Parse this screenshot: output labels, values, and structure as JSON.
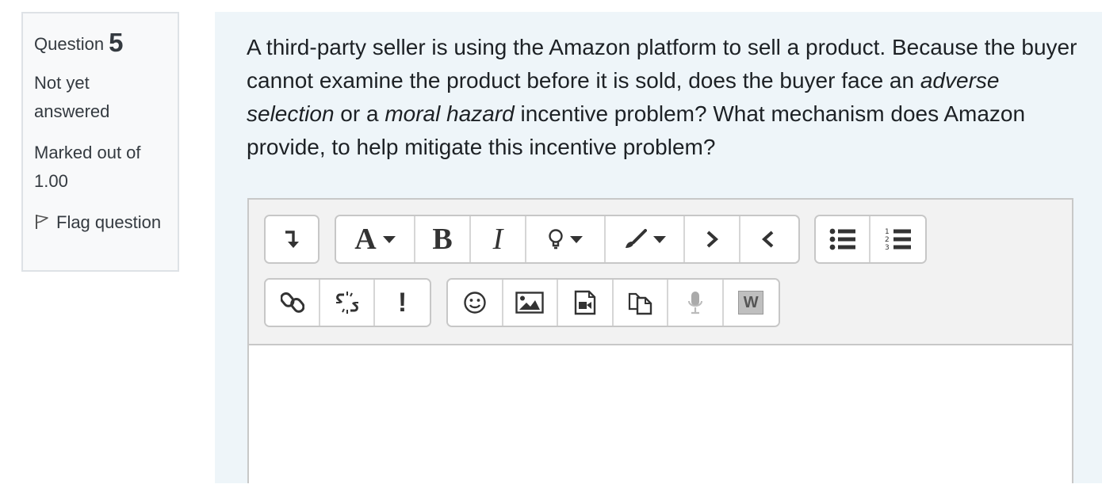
{
  "info": {
    "question_label": "Question",
    "question_number": "5",
    "state": "Not yet answered",
    "grade": "Marked out of 1.00",
    "flag_label": "Flag question"
  },
  "question": {
    "part1": "A third-party seller is using the Amazon platform to sell a product. Because the buyer cannot examine the product before it is sold, does the buyer face an ",
    "term1": "adverse selection",
    "part2": " or a ",
    "term2": "moral hazard",
    "part3": " incentive problem? What mechanism does Amazon provide, to help mitigate this incentive problem?"
  },
  "editor": {
    "toolbar_row1": [
      "show-more-icon",
      "font-style-icon",
      "bold-icon",
      "italic-icon",
      "lightbulb-icon",
      "paintbrush-icon",
      "indent-icon",
      "outdent-icon",
      "unordered-list-icon",
      "ordered-list-icon"
    ],
    "toolbar_row2": [
      "link-icon",
      "unlink-icon",
      "no-autolink-icon",
      "emoticon-icon",
      "image-icon",
      "media-icon",
      "manage-files-icon",
      "record-audio-icon",
      "paste-from-word-icon"
    ],
    "bold_glyph": "B",
    "italic_glyph": "I",
    "font_glyph": "A",
    "exclaim_glyph": "!",
    "word_glyph": "W",
    "content": ""
  }
}
